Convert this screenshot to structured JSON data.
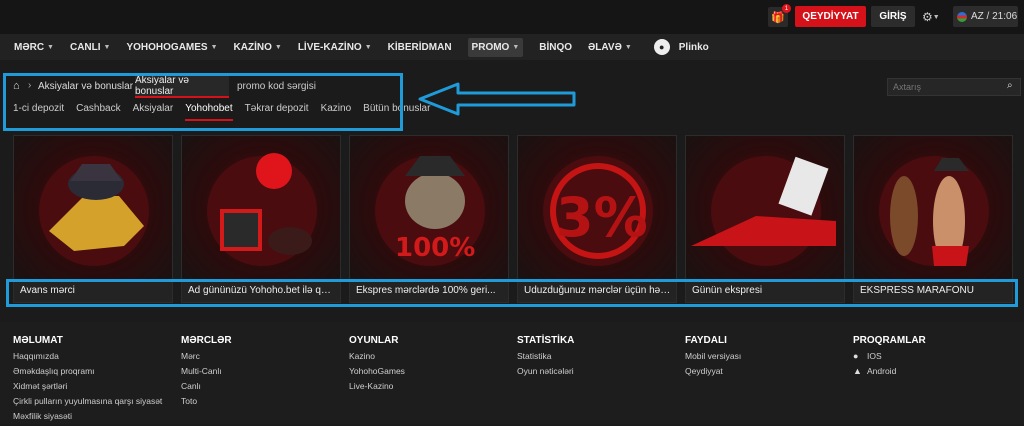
{
  "topbar": {
    "gift_badge": "1",
    "register_label": "QEYDİYYAT",
    "login_label": "GİRİŞ",
    "lang_time": "AZ / 21:06"
  },
  "nav": {
    "items": [
      {
        "label": "MƏRC",
        "chevron": true
      },
      {
        "label": "CANLI",
        "chevron": true
      },
      {
        "label": "YOHOHOGAMES",
        "chevron": true
      },
      {
        "label": "KAZİNO",
        "chevron": true
      },
      {
        "label": "LİVE-KAZİNO",
        "chevron": true
      },
      {
        "label": "KİBERİDMAN",
        "chevron": false
      },
      {
        "label": "PROMO",
        "chevron": true
      },
      {
        "label": "BİNQO",
        "chevron": false
      },
      {
        "label": "ƏLAVƏ",
        "chevron": true
      }
    ],
    "plinko_label": "Plinko"
  },
  "breadcrumb": {
    "current": "Aksiyalar və bonuslar",
    "tab_active": "Aksiyalar və bonuslar",
    "tab_other": "promo kod sərgisi"
  },
  "search": {
    "placeholder": "Axtarış"
  },
  "subtabs": [
    "1-ci depozit",
    "Cashback",
    "Aksiyalar",
    "Yohohobet",
    "Təkrar depozit",
    "Kazino",
    "Bütün bonuslar"
  ],
  "cards": [
    {
      "title": "Avans mərci",
      "icon": "handshake-icon"
    },
    {
      "title": "Ad gününüzü Yohoho.bet ilə qeyd...",
      "icon": "gift-balloon-icon"
    },
    {
      "title": "Ekspres mərclərdə 100% geri...",
      "icon": "cat-pirate-icon"
    },
    {
      "title": "Uduzduğunuz mərclər üçün həftəli...",
      "icon": "percent-icon"
    },
    {
      "title": "Günün ekspresi",
      "icon": "train-ticket-icon"
    },
    {
      "title": "EKSPRESS MARAFONU",
      "icon": "runners-icon"
    }
  ],
  "footer": {
    "columns": [
      {
        "heading": "MƏLUMAT",
        "links": [
          "Haqqımızda",
          "Əməkdaşlıq proqramı",
          "Xidmət şərtləri",
          "Çirkli pulların yuyulmasına qarşı siyasət",
          "Məxfilik siyasəti"
        ]
      },
      {
        "heading": "MƏRCLƏR",
        "links": [
          "Mərc",
          "Multi-Canlı",
          "Canlı",
          "Toto"
        ]
      },
      {
        "heading": "OYUNLAR",
        "links": [
          "Kazino",
          "YohohoGames",
          "Live-Kazino"
        ]
      },
      {
        "heading": "STATİSTİKA",
        "links": [
          "Statistika",
          "Oyun nəticələri"
        ]
      },
      {
        "heading": "FAYDALI",
        "links": [
          "Mobil versiyası",
          "Qeydiyyat"
        ]
      },
      {
        "heading": "PROQRAMLAR",
        "links": [
          "IOS",
          "Android"
        ]
      }
    ]
  },
  "colors": {
    "accent": "#d5121a",
    "highlight": "#1f9bd9",
    "background": "#1b1b1b"
  }
}
